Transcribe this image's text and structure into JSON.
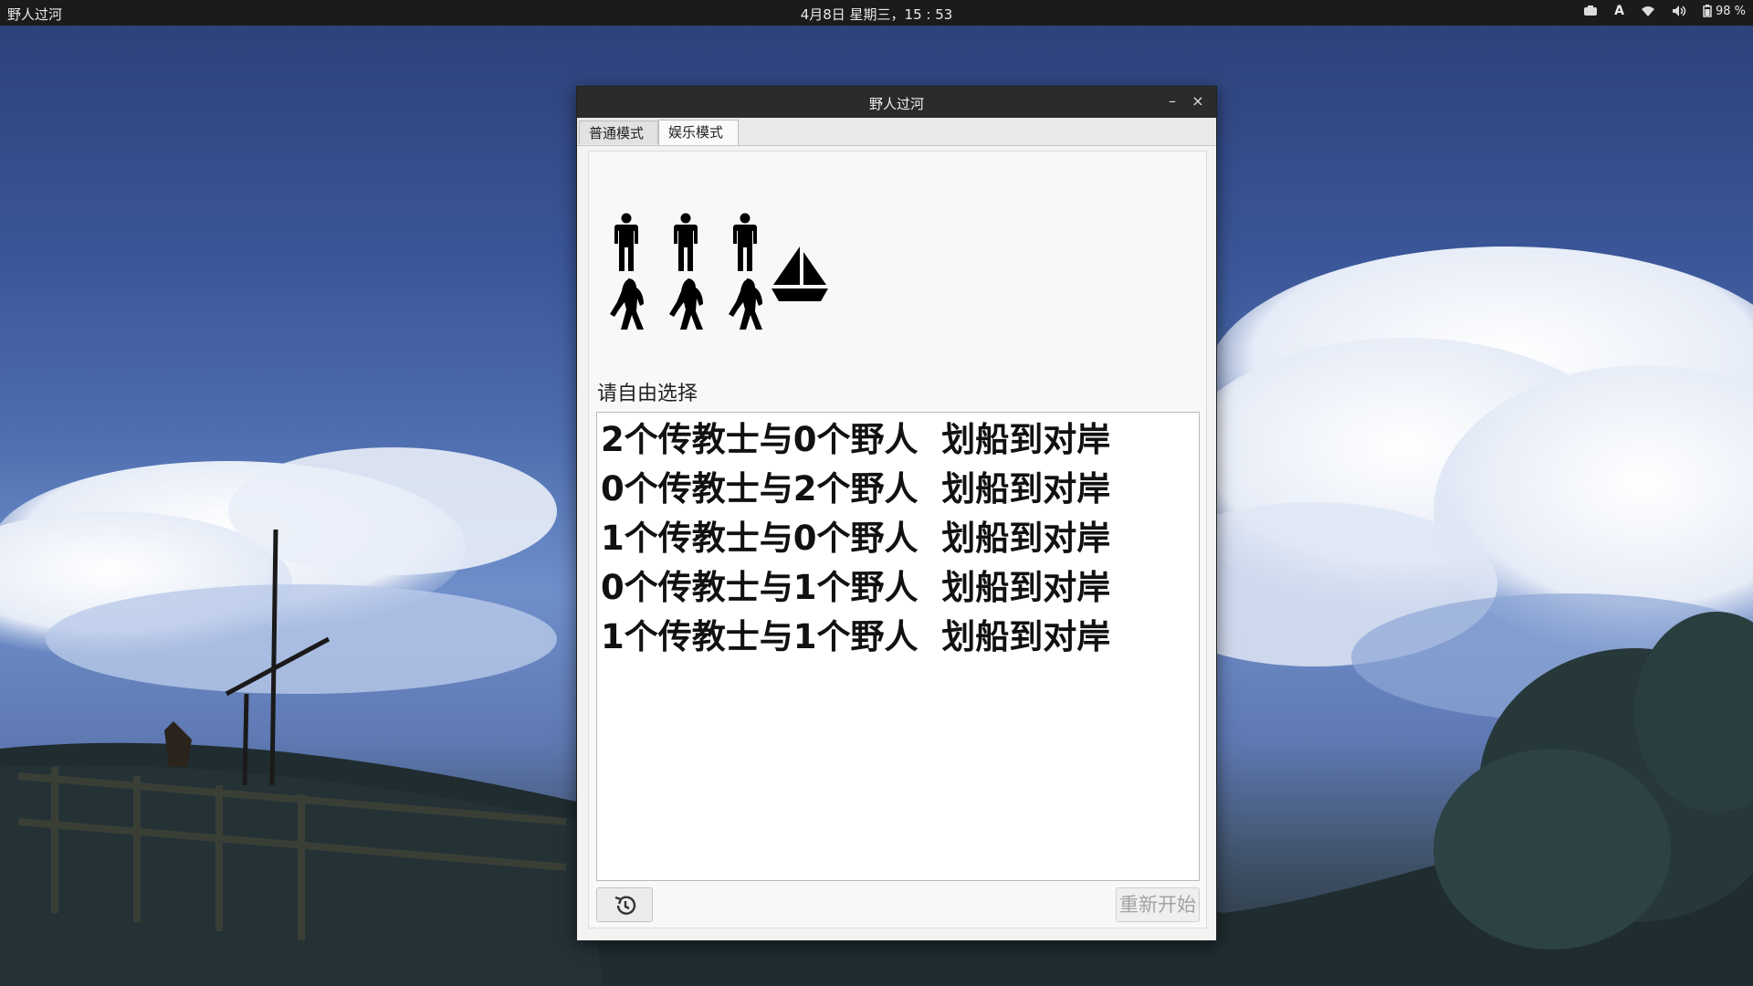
{
  "panel": {
    "app_name": "野人过河",
    "clock": "4月8日 星期三，15 : 53",
    "keyboard_indicator": "A",
    "battery": "98 %"
  },
  "window": {
    "title": "野人过河",
    "minimize_label": "–",
    "close_label": "×",
    "tabs": [
      {
        "label": "普通模式",
        "active": false
      },
      {
        "label": "娱乐模式",
        "active": true
      }
    ]
  },
  "scene": {
    "missionaries_on_bank": 3,
    "savages_on_bank": 3,
    "boat_icon": "sailboat-icon",
    "missionary_icon": "person-icon",
    "savage_icon": "bigfoot-icon"
  },
  "prompt": "请自由选择",
  "options": [
    "2个传教士与0个野人  划船到对岸",
    "0个传教士与2个野人  划船到对岸",
    "1个传教士与0个野人  划船到对岸",
    "0个传教士与1个野人  划船到对岸",
    "1个传教士与1个野人  划船到对岸"
  ],
  "buttons": {
    "history_icon": "history-icon",
    "restart_label": "重新开始"
  },
  "colors": {
    "panel_bg": "#1b1b1b",
    "titlebar_bg": "#2b2b2b",
    "window_bg": "#f3f3f3",
    "option_text": "#111111",
    "restart_text": "#a3a3a3"
  }
}
